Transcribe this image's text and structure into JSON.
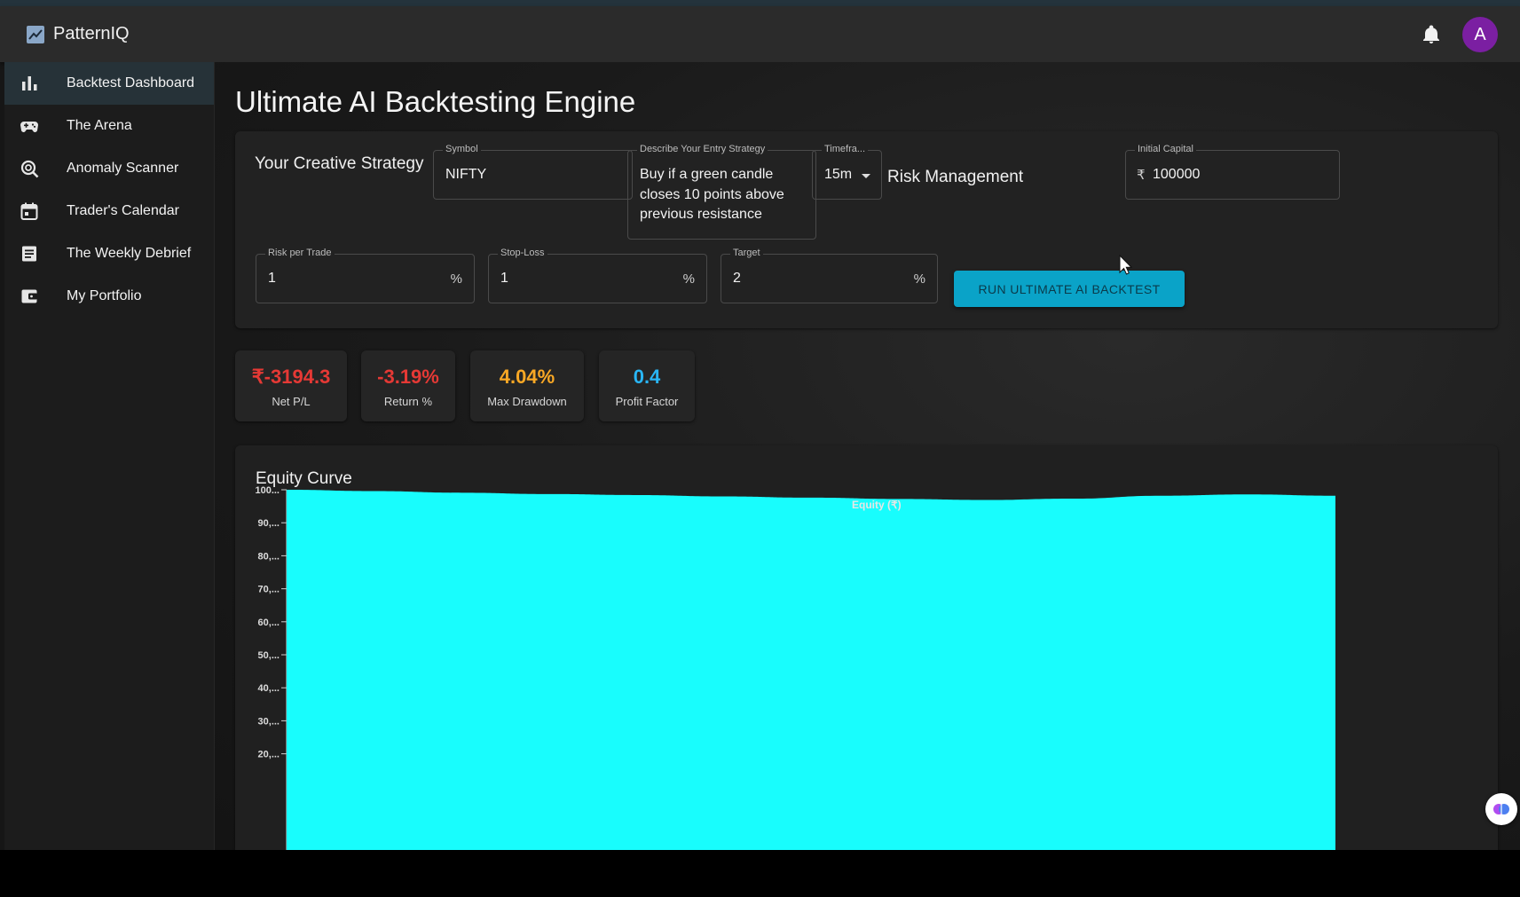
{
  "app": {
    "name": "PatternIQ",
    "avatar_letter": "A",
    "accent": "#0aa3c8"
  },
  "sidebar": {
    "items": [
      {
        "label": "Backtest Dashboard",
        "icon": "bar-chart-icon",
        "active": true
      },
      {
        "label": "The Arena",
        "icon": "gamepad-icon",
        "active": false
      },
      {
        "label": "Anomaly Scanner",
        "icon": "search-scan-icon",
        "active": false
      },
      {
        "label": "Trader's Calendar",
        "icon": "calendar-icon",
        "active": false
      },
      {
        "label": "The Weekly Debrief",
        "icon": "article-icon",
        "active": false
      },
      {
        "label": "My Portfolio",
        "icon": "wallet-icon",
        "active": false
      }
    ]
  },
  "page": {
    "title": "Ultimate AI Backtesting Engine"
  },
  "form": {
    "strategy_label": "Your Creative Strategy",
    "symbol": {
      "label": "Symbol",
      "value": "NIFTY"
    },
    "entry": {
      "label": "Describe Your Entry Strategy",
      "value": "Buy if a green candle closes 10 points above previous resistance"
    },
    "timeframe": {
      "label": "Timefra...",
      "value": "15m"
    },
    "risk_label": "Risk Management",
    "capital": {
      "label": "Initial Capital",
      "prefix": "₹",
      "value": "100000"
    },
    "risk_per_trade": {
      "label": "Risk per Trade",
      "value": "1",
      "suffix": "%"
    },
    "stop_loss": {
      "label": "Stop-Loss",
      "value": "1",
      "suffix": "%"
    },
    "target": {
      "label": "Target",
      "value": "2",
      "suffix": "%"
    },
    "run_button": "RUN ULTIMATE AI BACKTEST"
  },
  "stats": [
    {
      "value": "₹-3194.3",
      "label": "Net P/L",
      "color": "#e53935"
    },
    {
      "value": "-3.19%",
      "label": "Return %",
      "color": "#e53935"
    },
    {
      "value": "4.04%",
      "label": "Max Drawdown",
      "color": "#f9a825"
    },
    {
      "value": "0.4",
      "label": "Profit Factor",
      "color": "#29b6f6"
    }
  ],
  "chart_data": {
    "type": "area",
    "title": "Equity Curve",
    "legend": "top-center",
    "series": [
      {
        "name": "Equity (₹)",
        "color": "#18fdfd",
        "values": [
          100,
          99.6,
          99.1,
          98.7,
          98.4,
          98.0,
          97.6,
          97.2,
          96.9,
          97.3,
          98.2,
          98.6,
          98.2
        ]
      }
    ],
    "y_ticks": [
      "100...",
      "90,...",
      "80,...",
      "70,...",
      "60,...",
      "50,...",
      "40,...",
      "30,...",
      "20,..."
    ],
    "ylim": [
      13,
      100
    ]
  }
}
